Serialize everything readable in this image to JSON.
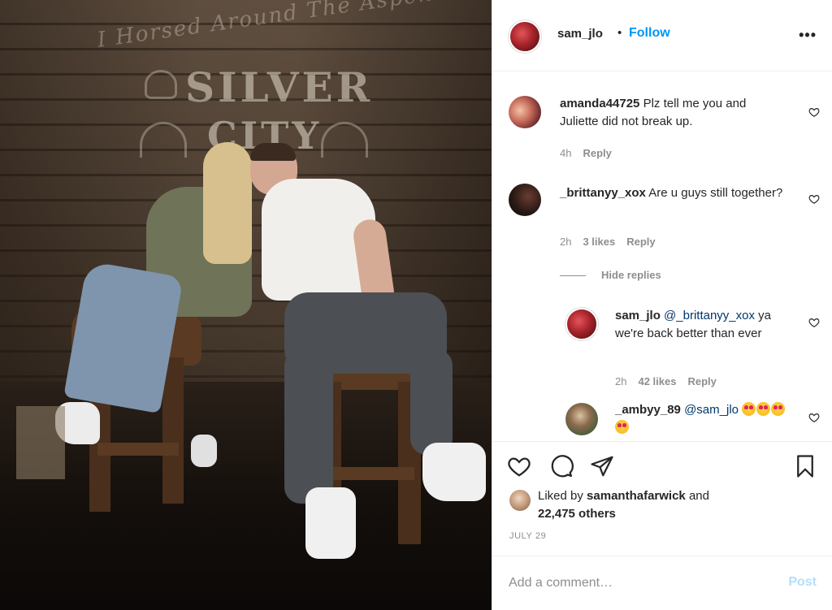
{
  "photo": {
    "sign_script": "I Horsed Around The Aspen",
    "sign_line1": "SILVER",
    "sign_line2": "CITY"
  },
  "header": {
    "username": "sam_jlo",
    "separator": "•",
    "follow_label": "Follow",
    "more_icon": "more-options-icon"
  },
  "comments": [
    {
      "username": "amanda44725",
      "text": "Plz tell me you and Juliette did not break up.",
      "time": "4h",
      "likes": "",
      "reply_label": "Reply"
    },
    {
      "username": "_brittanyy_xox",
      "text": "Are u guys still together?",
      "time": "2h",
      "likes": "3 likes",
      "reply_label": "Reply",
      "hide_replies_label": "Hide replies",
      "replies": [
        {
          "username": "sam_jlo",
          "mention": "@_brittanyy_xox",
          "text": "ya we're back better than ever",
          "time": "2h",
          "likes": "42 likes",
          "reply_label": "Reply"
        },
        {
          "username": "_ambyy_89",
          "mention": "@sam_jlo",
          "text": "😍😍😍😍",
          "time": "",
          "likes": "",
          "reply_label": ""
        }
      ]
    }
  ],
  "actions": {
    "icons": [
      "heart-icon",
      "comment-icon",
      "share-icon",
      "bookmark-icon"
    ],
    "liked_by_prefix": "Liked by",
    "liked_by_user": "samanthafarwick",
    "liked_by_and": "and",
    "others_count": "22,475 others",
    "date": "JULY 29"
  },
  "add_comment": {
    "placeholder": "Add a comment…",
    "post_label": "Post"
  },
  "colors": {
    "link_blue": "#0095f6",
    "mention_blue": "#00376b",
    "post_disabled": "#b2dffc",
    "meta_gray": "#8e8e8e",
    "text": "#262626"
  }
}
